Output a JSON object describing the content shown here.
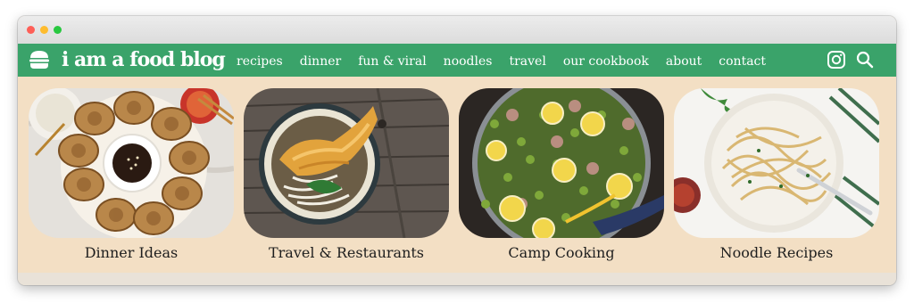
{
  "site": {
    "logo_text": "i am a food blog",
    "brand_color": "#3aa36a",
    "background_color": "#f3dfc4",
    "logo_icon": "burger-icon"
  },
  "nav": {
    "items": [
      {
        "label": "recipes"
      },
      {
        "label": "dinner"
      },
      {
        "label": "fun & viral"
      },
      {
        "label": "noodles"
      },
      {
        "label": "travel"
      },
      {
        "label": "our cookbook"
      },
      {
        "label": "about"
      },
      {
        "label": "contact"
      }
    ],
    "icons": [
      "instagram-icon",
      "search-icon"
    ]
  },
  "categories": [
    {
      "label": "Dinner Ideas",
      "image": "fried-dumplings-with-dipping-sauce"
    },
    {
      "label": "Travel & Restaurants",
      "image": "udon-bowl-with-tempura"
    },
    {
      "label": "Camp Cooking",
      "image": "pea-and-lemon-skillet"
    },
    {
      "label": "Noodle Recipes",
      "image": "spaghetti-in-white-bowl"
    }
  ]
}
